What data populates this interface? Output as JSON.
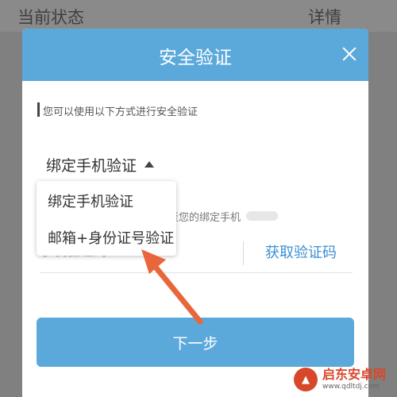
{
  "background": {
    "left_text": "当前状态",
    "right_text": "详情"
  },
  "modal": {
    "title": "安全验证",
    "close_icon": "close-icon",
    "hint": "您可以使用以下方式进行安全验证",
    "method_selected": "绑定手机验证",
    "masked_message": "至您的绑定手机",
    "code_placeholder": "手机验证码",
    "get_code_label": "获取验证码",
    "next_label": "下一步"
  },
  "dropdown": {
    "options": [
      "绑定手机验证",
      "邮箱+身份证号验证"
    ]
  },
  "watermark": {
    "name": "启东安卓网",
    "url": "www.qdltdj.com"
  },
  "colors": {
    "accent": "#5ba9db",
    "link": "#3d8fd2",
    "arrow": "#e8663a"
  }
}
